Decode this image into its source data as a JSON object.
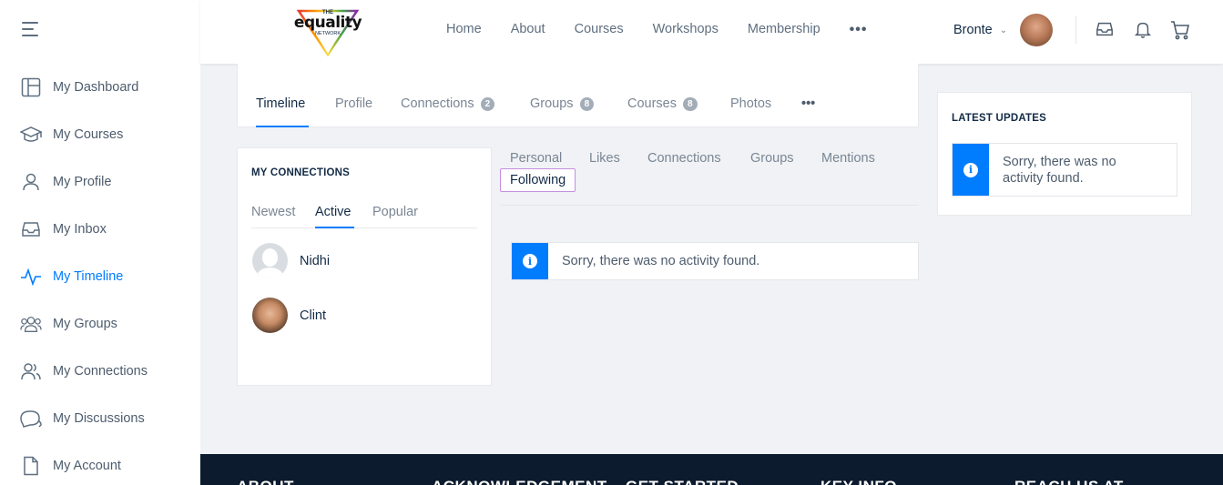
{
  "sidebar": {
    "items": [
      {
        "label": "My Dashboard",
        "icon": "dashboard-icon"
      },
      {
        "label": "My Courses",
        "icon": "graduation-cap-icon"
      },
      {
        "label": "My Profile",
        "icon": "user-icon"
      },
      {
        "label": "My Inbox",
        "icon": "inbox-icon"
      },
      {
        "label": "My Timeline",
        "icon": "activity-icon",
        "active": true
      },
      {
        "label": "My Groups",
        "icon": "groups-icon"
      },
      {
        "label": "My Connections",
        "icon": "connections-icon"
      },
      {
        "label": "My Discussions",
        "icon": "discussions-icon"
      },
      {
        "label": "My Account",
        "icon": "document-icon"
      }
    ]
  },
  "header": {
    "logo": {
      "small": "THE",
      "word": "equality",
      "sub": "NETWORK"
    },
    "nav": [
      "Home",
      "About",
      "Courses",
      "Workshops",
      "Membership"
    ],
    "more": "•••",
    "user_name": "Bronte",
    "chevron": "⌄"
  },
  "profile_tabs": [
    {
      "label": "Timeline",
      "active": true
    },
    {
      "label": "Profile"
    },
    {
      "label": "Connections",
      "badge": "2"
    },
    {
      "label": "Groups",
      "badge": "8"
    },
    {
      "label": "Courses",
      "badge": "8"
    },
    {
      "label": "Photos"
    }
  ],
  "profile_tabs_more": "•••",
  "connections": {
    "title": "MY CONNECTIONS",
    "tabs": [
      "Newest",
      "Active",
      "Popular"
    ],
    "members": [
      {
        "name": "Nidhi"
      },
      {
        "name": "Clint"
      }
    ]
  },
  "activity": {
    "subtabs": [
      "Personal",
      "Likes",
      "Connections",
      "Groups",
      "Mentions",
      "Following"
    ],
    "empty_message": "Sorry, there was no activity found."
  },
  "updates": {
    "title": "LATEST UPDATES",
    "line1": "Sorry, there was no",
    "line2": "activity found."
  },
  "footer": {
    "columns": [
      "ABOUT",
      "ACKNOWLEDGEMENT",
      "GET STARTED",
      "KEY INFO",
      "REACH US AT"
    ]
  },
  "colors": {
    "accent": "#007cff",
    "footer_bg": "#0c1b2d",
    "page_bg": "#f0f2f5"
  }
}
